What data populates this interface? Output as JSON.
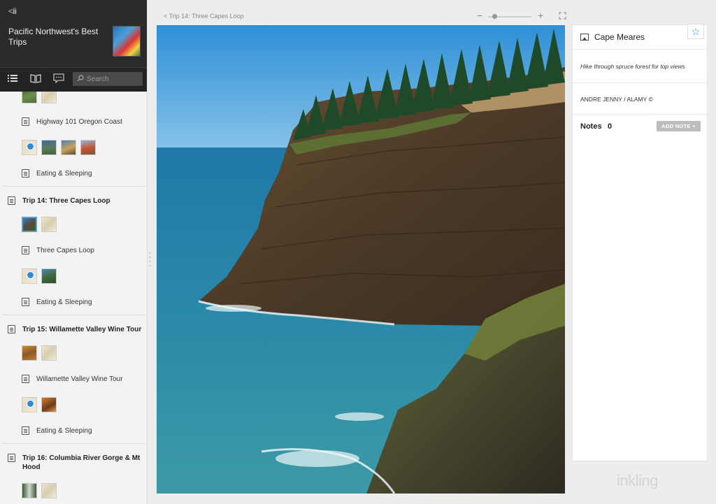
{
  "book": {
    "back_label": "<iii",
    "title": "Pacific Northwest's Best Trips",
    "search_placeholder": "Search"
  },
  "toc": {
    "item_highway": "Highway 101 Oregon Coast",
    "item_eating_1": "Eating & Sleeping",
    "chapters": [
      {
        "title": "Trip 14: Three Capes Loop",
        "item": "Three Capes Loop",
        "eating": "Eating & Sleeping"
      },
      {
        "title": "Trip 15: Willamette Valley Wine Tour",
        "item": "Willamette Valley Wine Tour",
        "eating": "Eating & Sleeping"
      },
      {
        "title": "Trip 16: Columbia River Gorge & Mt Hood"
      }
    ]
  },
  "viewer": {
    "breadcrumb": "< Trip 14: Three Capes Loop",
    "zoom_minus": "−",
    "zoom_plus": "+",
    "zoom_level": 0.1
  },
  "info": {
    "title": "Cape Meares",
    "caption": "Hike through spruce forest for top views",
    "credit": "ANDRE JENNY / ALAMY ©",
    "notes_label": "Notes",
    "notes_count": "0",
    "add_note_label": "ADD NOTE +"
  },
  "brand": "inkling",
  "colors": {
    "accent": "#2d8fd8",
    "header_bg": "#2b2b2b"
  },
  "icons": [
    "toc-list-icon",
    "book-icon",
    "chat-icon",
    "search-icon",
    "image-icon",
    "star-icon",
    "fullscreen-icon"
  ]
}
